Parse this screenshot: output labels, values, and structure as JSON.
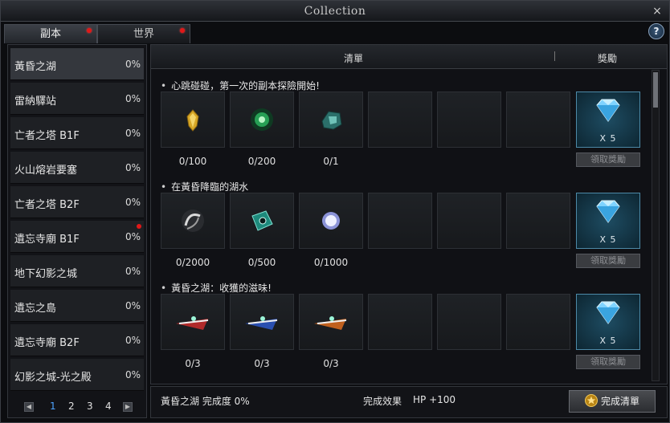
{
  "window": {
    "title": "Collection",
    "close_glyph": "×",
    "help_glyph": "?"
  },
  "tabs": [
    {
      "label": "副本",
      "active": true,
      "has_alert": true
    },
    {
      "label": "世界",
      "active": false,
      "has_alert": true
    }
  ],
  "dungeons": [
    {
      "name": "黃昏之湖",
      "progress": "0%",
      "active": true,
      "alert": false
    },
    {
      "name": "雷納驛站",
      "progress": "0%",
      "active": false,
      "alert": false
    },
    {
      "name": "亡者之塔 B1F",
      "progress": "0%",
      "active": false,
      "alert": false
    },
    {
      "name": "火山熔岩要塞",
      "progress": "0%",
      "active": false,
      "alert": false
    },
    {
      "name": "亡者之塔 B2F",
      "progress": "0%",
      "active": false,
      "alert": false
    },
    {
      "name": "遺忘寺廟 B1F",
      "progress": "0%",
      "active": false,
      "alert": true
    },
    {
      "name": "地下幻影之城",
      "progress": "0%",
      "active": false,
      "alert": false
    },
    {
      "name": "遺忘之島",
      "progress": "0%",
      "active": false,
      "alert": false
    },
    {
      "name": "遺忘寺廟 B2F",
      "progress": "0%",
      "active": false,
      "alert": false
    },
    {
      "name": "幻影之城-光之殿",
      "progress": "0%",
      "active": false,
      "alert": false
    }
  ],
  "pager": {
    "prev_glyph": "◀",
    "next_glyph": "▶",
    "pages": [
      "1",
      "2",
      "3",
      "4"
    ],
    "current": "1"
  },
  "header": {
    "list_label": "清單",
    "reward_label": "獎勵"
  },
  "sections": [
    {
      "title": "心跳碰碰，第一次的副本探險開始!",
      "items": [
        {
          "icon": "gold-crystal-icon",
          "count": "0/100"
        },
        {
          "icon": "green-orb-icon",
          "count": "0/200"
        },
        {
          "icon": "teal-ore-icon",
          "count": "0/1"
        }
      ],
      "reward": {
        "icon": "blue-diamond-icon",
        "qty": "X 5",
        "claim_label": "領取獎勵"
      }
    },
    {
      "title": "在黃昏降臨的湖水",
      "items": [
        {
          "icon": "silver-swirl-icon",
          "count": "0/2000"
        },
        {
          "icon": "teal-gem-icon",
          "count": "0/500"
        },
        {
          "icon": "white-gem-icon",
          "count": "0/1000"
        }
      ],
      "reward": {
        "icon": "blue-diamond-icon",
        "qty": "X 5",
        "claim_label": "領取獎勵"
      }
    },
    {
      "title": "黃昏之湖：收獲的滋味!",
      "items": [
        {
          "icon": "red-wing-blade-icon",
          "count": "0/3"
        },
        {
          "icon": "blue-wing-blade-icon",
          "count": "0/3"
        },
        {
          "icon": "orange-wing-blade-icon",
          "count": "0/3"
        }
      ],
      "reward": {
        "icon": "blue-diamond-icon",
        "qty": "X 5",
        "claim_label": "領取獎勵"
      }
    }
  ],
  "footer": {
    "completion": "黃昏之湖 完成度 0%",
    "effect_label": "完成效果",
    "effect_value": "HP +100",
    "complete_button": "完成清單"
  }
}
